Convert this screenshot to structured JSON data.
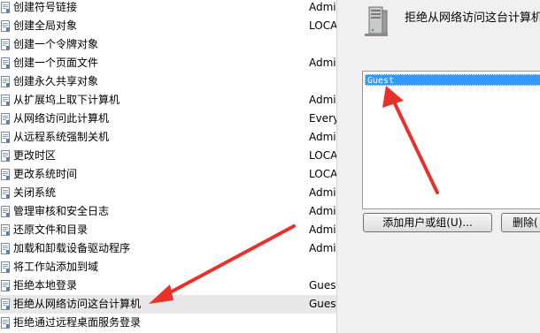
{
  "rights_list": {
    "rows": [
      {
        "name": "创建符号链接",
        "value": "Admi"
      },
      {
        "name": "创建全局对象",
        "value": "LOCA"
      },
      {
        "name": "创建一个令牌对象",
        "value": ""
      },
      {
        "name": "创建一个页面文件",
        "value": "Admi"
      },
      {
        "name": "创建永久共享对象",
        "value": ""
      },
      {
        "name": "从扩展坞上取下计算机",
        "value": "Admi"
      },
      {
        "name": "从网络访问此计算机",
        "value": "Every"
      },
      {
        "name": "从远程系统强制关机",
        "value": "Admi"
      },
      {
        "name": "更改时区",
        "value": "LOCA"
      },
      {
        "name": "更改系统时间",
        "value": "LOCA"
      },
      {
        "name": "关闭系统",
        "value": "Admi"
      },
      {
        "name": "管理审核和安全日志",
        "value": "Admi"
      },
      {
        "name": "还原文件和目录",
        "value": "Admi"
      },
      {
        "name": "加载和卸载设备驱动程序",
        "value": "Admi"
      },
      {
        "name": "将工作站添加到域",
        "value": ""
      },
      {
        "name": "拒绝本地登录",
        "value": "Guest"
      },
      {
        "name": "拒绝从网络访问这台计算机",
        "value": "Guest"
      },
      {
        "name": "拒绝通过远程桌面服务登录",
        "value": ""
      }
    ],
    "selected_index": 16
  },
  "dialog": {
    "title": "拒绝从网络访问这台计算机",
    "members": [
      "Guest"
    ],
    "add_button": "添加用户或组(U)...",
    "remove_button": "删除("
  },
  "colors": {
    "selection": "#3399ff",
    "arrow": "#e8312a",
    "row_selected": "#e8e8e8"
  }
}
